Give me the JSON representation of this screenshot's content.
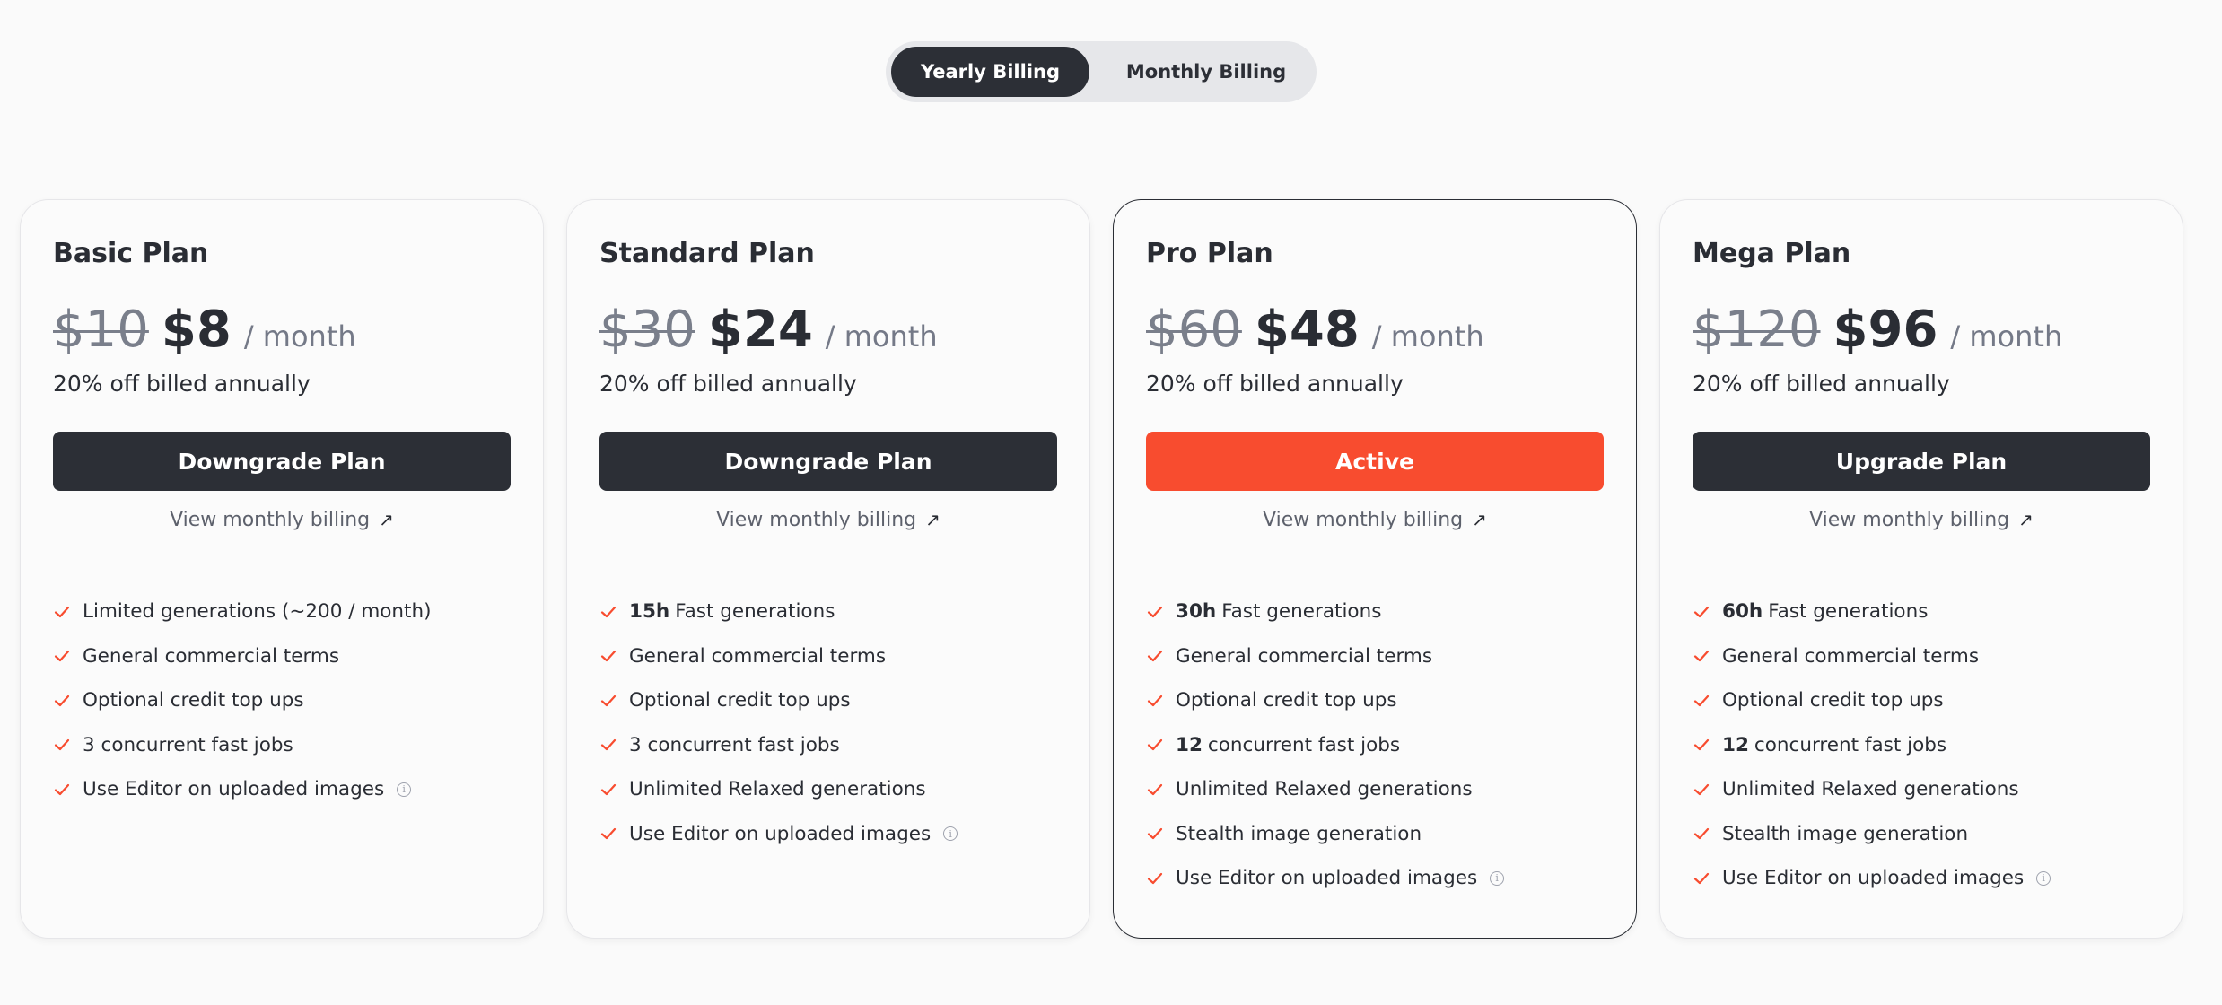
{
  "billing_toggle": {
    "yearly": "Yearly Billing",
    "monthly": "Monthly Billing",
    "selected": "yearly"
  },
  "accent_color": "#f84c2f",
  "dark_color": "#2c2f36",
  "plans": [
    {
      "title": "Basic Plan",
      "old_price": "$10",
      "price": "$8",
      "per": "/ month",
      "billed": "20% off billed annually",
      "action": "Downgrade Plan",
      "view_link": "View monthly billing",
      "features": [
        {
          "bold": "",
          "text": "Limited generations (~200 / month)",
          "info": false
        },
        {
          "bold": "",
          "text": "General commercial terms",
          "info": false
        },
        {
          "bold": "",
          "text": "Optional credit top ups",
          "info": false
        },
        {
          "bold": "",
          "text": "3 concurrent fast jobs",
          "info": false
        },
        {
          "bold": "",
          "text": "Use Editor on uploaded images",
          "info": true
        }
      ]
    },
    {
      "title": "Standard Plan",
      "old_price": "$30",
      "price": "$24",
      "per": "/ month",
      "billed": "20% off billed annually",
      "action": "Downgrade Plan",
      "view_link": "View monthly billing",
      "features": [
        {
          "bold": "15h",
          "text": "Fast generations",
          "info": false
        },
        {
          "bold": "",
          "text": "General commercial terms",
          "info": false
        },
        {
          "bold": "",
          "text": "Optional credit top ups",
          "info": false
        },
        {
          "bold": "",
          "text": "3 concurrent fast jobs",
          "info": false
        },
        {
          "bold": "",
          "text": "Unlimited Relaxed generations",
          "info": false
        },
        {
          "bold": "",
          "text": "Use Editor on uploaded images",
          "info": true
        }
      ]
    },
    {
      "title": "Pro Plan",
      "old_price": "$60",
      "price": "$48",
      "per": "/ month",
      "billed": "20% off billed annually",
      "action": "Active",
      "view_link": "View monthly billing",
      "features": [
        {
          "bold": "30h",
          "text": "Fast generations",
          "info": false
        },
        {
          "bold": "",
          "text": "General commercial terms",
          "info": false
        },
        {
          "bold": "",
          "text": "Optional credit top ups",
          "info": false
        },
        {
          "bold": "12",
          "text": "concurrent fast jobs",
          "info": false
        },
        {
          "bold": "",
          "text": "Unlimited Relaxed generations",
          "info": false
        },
        {
          "bold": "",
          "text": "Stealth image generation",
          "info": false
        },
        {
          "bold": "",
          "text": "Use Editor on uploaded images",
          "info": true
        }
      ]
    },
    {
      "title": "Mega Plan",
      "old_price": "$120",
      "price": "$96",
      "per": "/ month",
      "billed": "20% off billed annually",
      "action": "Upgrade Plan",
      "view_link": "View monthly billing",
      "features": [
        {
          "bold": "60h",
          "text": "Fast generations",
          "info": false
        },
        {
          "bold": "",
          "text": "General commercial terms",
          "info": false
        },
        {
          "bold": "",
          "text": "Optional credit top ups",
          "info": false
        },
        {
          "bold": "12",
          "text": "concurrent fast jobs",
          "info": false
        },
        {
          "bold": "",
          "text": "Unlimited Relaxed generations",
          "info": false
        },
        {
          "bold": "",
          "text": "Stealth image generation",
          "info": false
        },
        {
          "bold": "",
          "text": "Use Editor on uploaded images",
          "info": true
        }
      ]
    }
  ]
}
